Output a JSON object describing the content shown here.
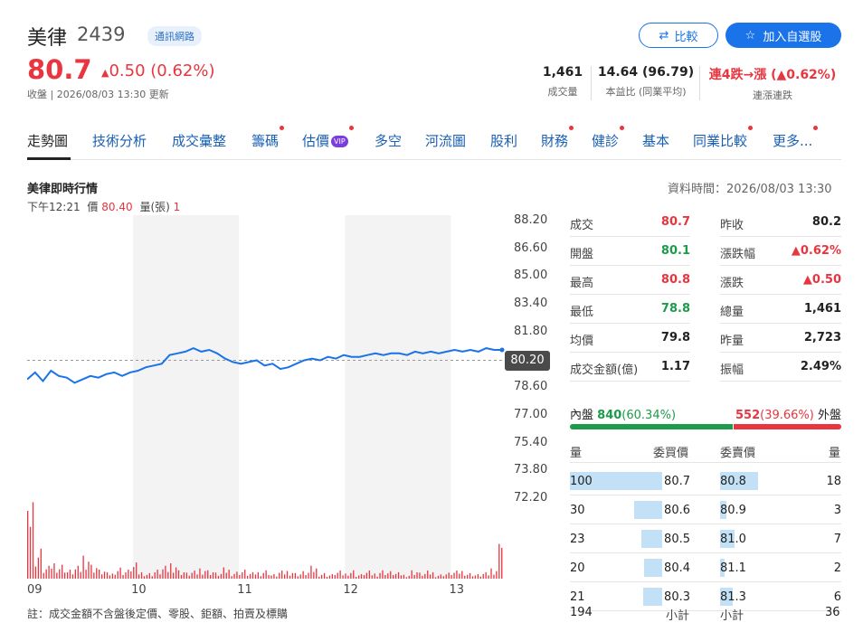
{
  "header": {
    "name": "美律",
    "code": "2439",
    "sector": "通訊網路",
    "compare_label": "比較",
    "watchlist_label": "加入自選股",
    "price": "80.7",
    "change": "0.50 (0.62%)",
    "update": "收盤 | 2026/08/03 13:30 更新"
  },
  "stats": [
    {
      "value": "1,461",
      "label": "成交量"
    },
    {
      "value": "14.64 (96.79)",
      "label": "本益比 (同業平均)"
    },
    {
      "value": "連4跌→漲 (▲0.62%)",
      "label": "連漲連跌"
    }
  ],
  "tabs": [
    "走勢圖",
    "技術分析",
    "成交彙整",
    "籌碼",
    "估價",
    "多空",
    "河流圖",
    "股利",
    "財務",
    "健診",
    "基本",
    "同業比較",
    "更多..."
  ],
  "vip_label": "VIP",
  "chart": {
    "title": "美律即時行情",
    "data_time": "資料時間：2026/08/03 13:30",
    "tick_time": "下午12:21",
    "tick_price_label": "價",
    "tick_price": "80.40",
    "tick_vol_label": "量(張)",
    "tick_vol": "1",
    "prev_close_label": "80.20",
    "footnote": "註：成交金額不含盤後定價、零股、鉅額、拍賣及標購"
  },
  "chart_data": {
    "type": "line",
    "y_ticks": [
      "88.20",
      "86.60",
      "85.00",
      "83.40",
      "81.80",
      "80.20",
      "78.60",
      "77.00",
      "75.40",
      "73.80",
      "72.20"
    ],
    "x_ticks": [
      "09",
      "10",
      "11",
      "12",
      "13"
    ],
    "ylim": [
      72.2,
      88.2
    ],
    "prev_close": 80.2,
    "prices": [
      79.1,
      79.5,
      79.0,
      79.6,
      79.3,
      79.2,
      78.9,
      79.1,
      79.3,
      79.2,
      79.4,
      79.5,
      79.3,
      79.5,
      79.6,
      79.8,
      79.9,
      80.0,
      80.5,
      80.6,
      80.7,
      80.9,
      80.7,
      80.8,
      80.6,
      80.3,
      80.1,
      80.0,
      80.1,
      80.2,
      79.9,
      80.0,
      79.7,
      79.8,
      80.0,
      80.2,
      80.3,
      80.2,
      80.4,
      80.3,
      80.5,
      80.4,
      80.4,
      80.5,
      80.6,
      80.5,
      80.6,
      80.6,
      80.5,
      80.7,
      80.6,
      80.7,
      80.6,
      80.7,
      80.8,
      80.7,
      80.8,
      80.7,
      80.9,
      80.8,
      80.8
    ],
    "volumes": [
      55,
      20,
      8,
      12,
      10,
      6,
      8,
      18,
      10,
      6,
      4,
      8,
      6,
      10,
      5,
      4,
      6,
      8,
      12,
      6,
      4,
      5,
      8,
      6,
      4,
      7,
      5,
      6,
      4,
      5,
      6,
      3,
      5,
      6,
      4,
      5,
      8,
      4,
      3,
      5,
      4,
      6,
      3,
      5,
      4,
      6,
      5,
      4,
      3,
      6,
      4,
      5,
      3,
      4,
      5,
      6,
      4,
      3,
      4,
      8,
      25
    ]
  },
  "quote": {
    "left": [
      {
        "label": "成交",
        "value": "80.7",
        "color": "red"
      },
      {
        "label": "開盤",
        "value": "80.1",
        "color": "green"
      },
      {
        "label": "最高",
        "value": "80.8",
        "color": "red"
      },
      {
        "label": "最低",
        "value": "78.8",
        "color": "green"
      },
      {
        "label": "均價",
        "value": "79.8",
        "color": "black"
      },
      {
        "label": "成交金額(億)",
        "value": "1.17",
        "color": "black"
      }
    ],
    "right": [
      {
        "label": "昨收",
        "value": "80.2",
        "color": "black"
      },
      {
        "label": "漲跌幅",
        "value": "▲0.62%",
        "color": "red"
      },
      {
        "label": "漲跌",
        "value": "▲0.50",
        "color": "red"
      },
      {
        "label": "總量",
        "value": "1,461",
        "color": "black"
      },
      {
        "label": "昨量",
        "value": "2,723",
        "color": "black"
      },
      {
        "label": "振幅",
        "value": "2.49%",
        "color": "black"
      }
    ]
  },
  "inout": {
    "in_label": "內盤",
    "in_value": "840",
    "in_pct": "(60.34%)",
    "out_value": "552",
    "out_pct": "(39.66%)",
    "out_label": "外盤",
    "in_ratio": 0.6034
  },
  "orderbook": {
    "headers": [
      "量",
      "委買價",
      "委賣價",
      "量"
    ],
    "rows": [
      {
        "bid_vol": "100",
        "bid": "80.7",
        "ask": "80.8",
        "ask_vol": "18",
        "bid_n": 100,
        "ask_n": 18
      },
      {
        "bid_vol": "30",
        "bid": "80.6",
        "ask": "80.9",
        "ask_vol": "3",
        "bid_n": 30,
        "ask_n": 3
      },
      {
        "bid_vol": "23",
        "bid": "80.5",
        "ask": "81.0",
        "ask_vol": "7",
        "bid_n": 23,
        "ask_n": 7
      },
      {
        "bid_vol": "20",
        "bid": "80.4",
        "ask": "81.1",
        "ask_vol": "2",
        "bid_n": 20,
        "ask_n": 2
      },
      {
        "bid_vol": "21",
        "bid": "80.3",
        "ask": "81.3",
        "ask_vol": "6",
        "bid_n": 21,
        "ask_n": 6
      }
    ],
    "bid_total": "194",
    "bid_total_label": "小計",
    "ask_total_label": "小計",
    "ask_total": "36"
  }
}
